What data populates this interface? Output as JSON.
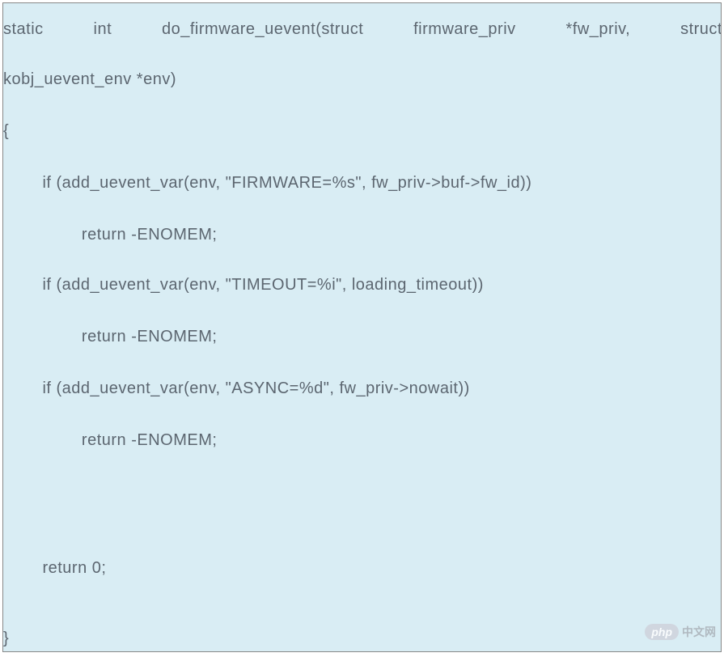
{
  "code": {
    "sig1_tokens": [
      "static",
      "int",
      "do_firmware_uevent(struct",
      "firmware_priv",
      "*fw_priv,",
      "struct"
    ],
    "sig2": "kobj_uevent_env *env)",
    "open_brace": "{",
    "l1": "        if (add_uevent_var(env, \"FIRMWARE=%s\", fw_priv->buf->fw_id))",
    "l2": "                return -ENOMEM;",
    "l3": "        if (add_uevent_var(env, \"TIMEOUT=%i\", loading_timeout))",
    "l4": "                return -ENOMEM;",
    "l5": "        if (add_uevent_var(env, \"ASYNC=%d\", fw_priv->nowait))",
    "l6": "                return -ENOMEM;",
    "l7": "        return 0;",
    "close_brace": "}"
  },
  "watermark": {
    "badge": "php",
    "text": "中文网"
  }
}
